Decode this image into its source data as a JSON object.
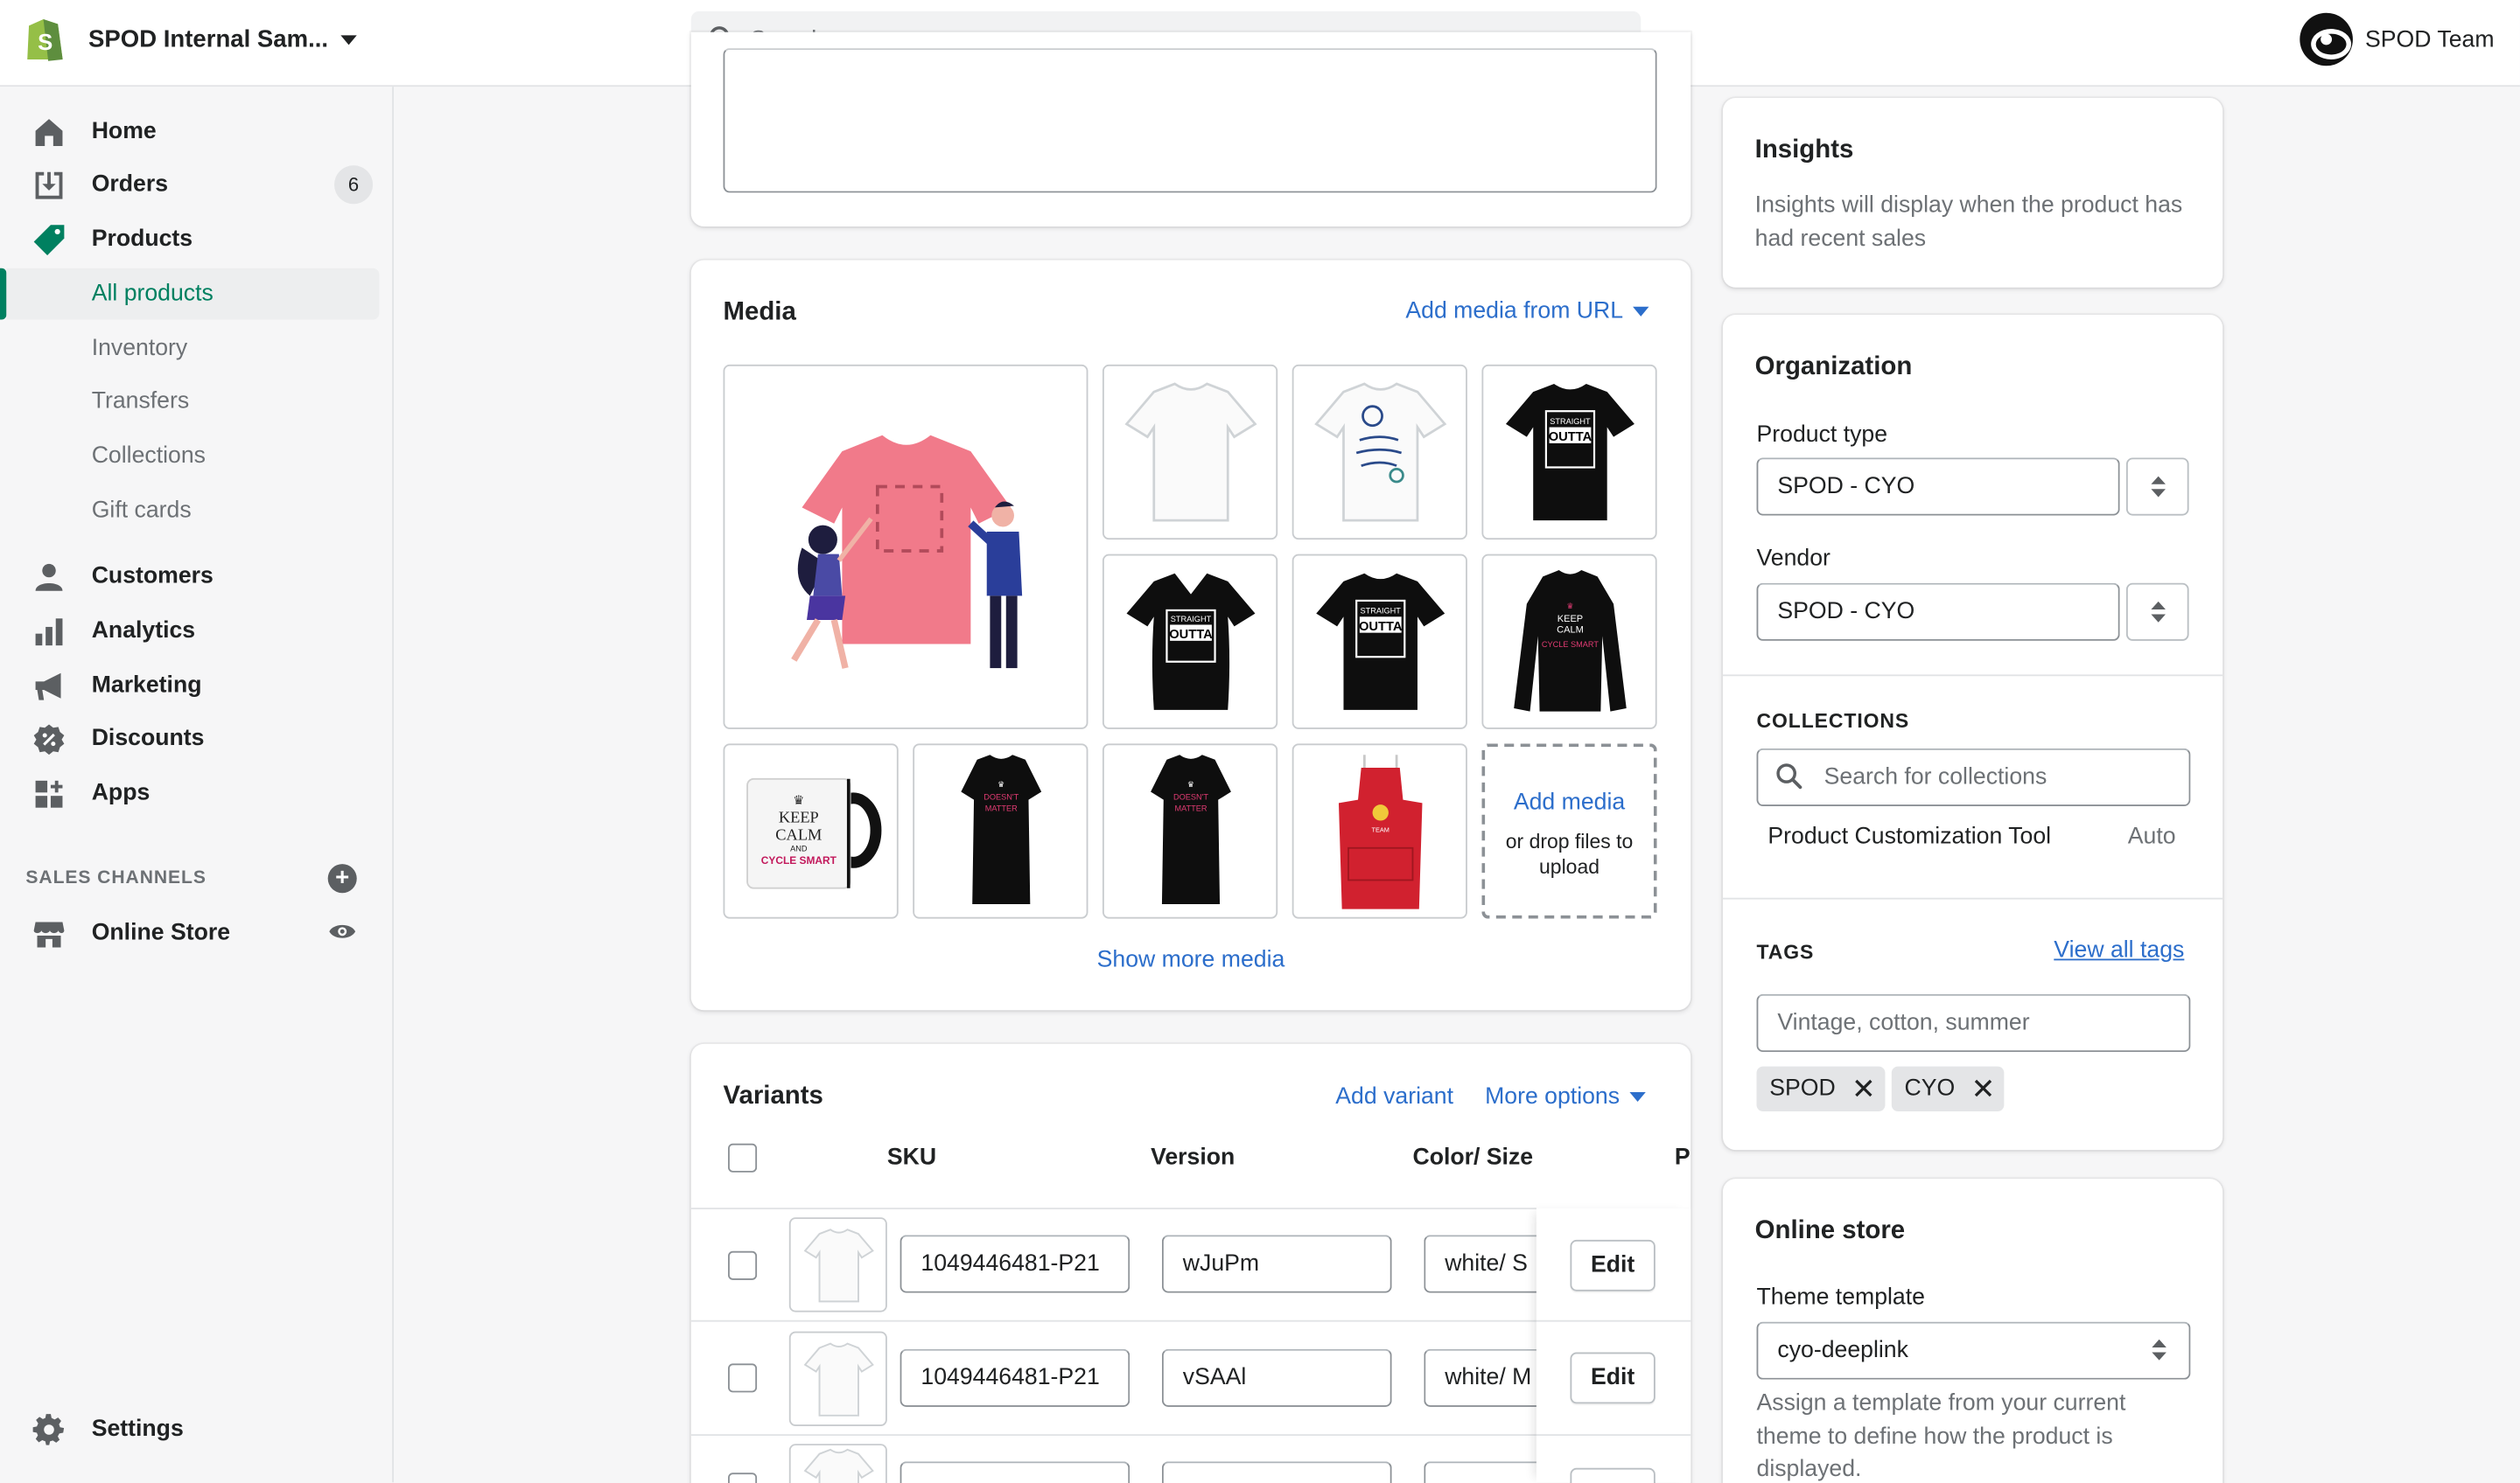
{
  "topbar": {
    "store_name": "SPOD Internal Sam...",
    "search_placeholder": "Search",
    "account_name": "SPOD Team"
  },
  "sidebar": {
    "home": "Home",
    "orders": "Orders",
    "orders_count": "6",
    "products": "Products",
    "sub": {
      "all_products": "All products",
      "inventory": "Inventory",
      "transfers": "Transfers",
      "collections": "Collections",
      "gift_cards": "Gift cards"
    },
    "customers": "Customers",
    "analytics": "Analytics",
    "marketing": "Marketing",
    "discounts": "Discounts",
    "apps": "Apps",
    "sales_channels_heading": "SALES CHANNELS",
    "online_store": "Online Store",
    "settings": "Settings"
  },
  "media": {
    "title": "Media",
    "add_from_url": "Add media from URL",
    "add_media": "Add media",
    "drop_text": "or drop files to upload",
    "show_more": "Show more media",
    "items": [
      {
        "name": "t-shirt-illustration"
      },
      {
        "name": "white-tshirt"
      },
      {
        "name": "white-tshirt-print"
      },
      {
        "name": "black-tshirt-straight-outta"
      },
      {
        "name": "black-vneck-straight-outta"
      },
      {
        "name": "black-tshirt-straight-outta-2"
      },
      {
        "name": "black-longsleeve-keep-calm"
      },
      {
        "name": "mug-keep-calm"
      },
      {
        "name": "black-dress-1"
      },
      {
        "name": "black-dress-2"
      },
      {
        "name": "red-apron"
      }
    ]
  },
  "variants": {
    "title": "Variants",
    "add_variant": "Add variant",
    "more_options": "More options",
    "columns": {
      "sku": "SKU",
      "version": "Version",
      "color_size": "Color/ Size",
      "price_partial": "P"
    },
    "rows": [
      {
        "sku": "1049446481-P21",
        "version": "wJuPm",
        "color_size": "white/ S",
        "edit": "Edit"
      },
      {
        "sku": "1049446481-P21",
        "version": "vSAAl",
        "color_size": "white/ M",
        "edit": "Edit"
      }
    ]
  },
  "insights": {
    "title": "Insights",
    "text": "Insights will display when the product has had recent sales"
  },
  "organization": {
    "title": "Organization",
    "product_type_label": "Product type",
    "product_type_value": "SPOD - CYO",
    "vendor_label": "Vendor",
    "vendor_value": "SPOD - CYO",
    "collections_heading": "COLLECTIONS",
    "collections_placeholder": "Search for collections",
    "collection_name": "Product Customization Tool",
    "collection_type": "Auto",
    "tags_heading": "TAGS",
    "view_all_tags": "View all tags",
    "tags_placeholder": "Vintage, cotton, summer",
    "tags": [
      "SPOD",
      "CYO"
    ]
  },
  "online_store": {
    "title": "Online store",
    "theme_label": "Theme template",
    "theme_value": "cyo-deeplink",
    "help": "Assign a template from your current theme to define how the product is displayed."
  },
  "colors": {
    "brand_green": "#008060",
    "link_blue": "#2c6ecb"
  }
}
